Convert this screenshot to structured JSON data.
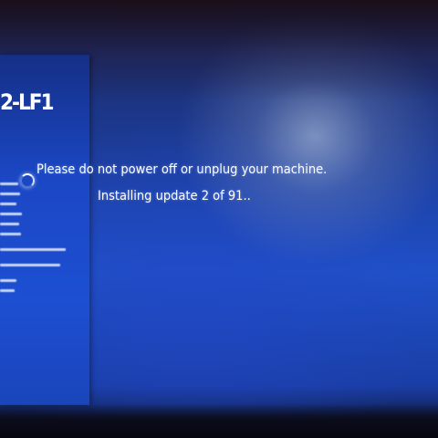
{
  "update_screen": {
    "message": "Please do not power off or unplug your machine.",
    "status": "Installing update 2 of 91..",
    "spinner_icon": "loading-spinner-icon"
  },
  "side_panel": {
    "title": "2-LF1"
  },
  "colors": {
    "background_blue": "#1f50c8",
    "panel_blue": "#1b47c4",
    "text": "#ffffff"
  }
}
